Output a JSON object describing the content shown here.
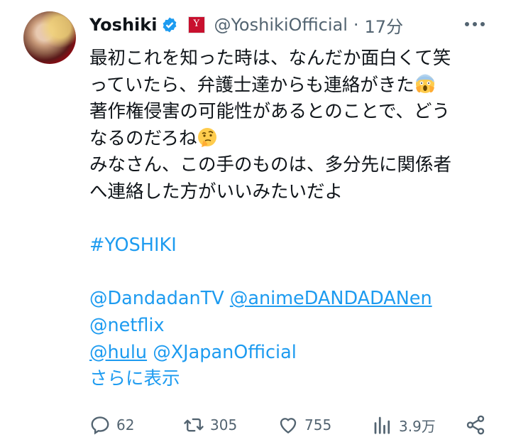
{
  "author": {
    "name": "Yoshiki",
    "handle": "@YoshikiOfficial",
    "separator": "·",
    "time": "17分"
  },
  "tweet": {
    "lines": [
      "最初これを知った時は、なんだか面白くて笑",
      "っていたら、弁護士達からも連絡がきた",
      "著作権侵害の可能性があるとのことで、どう",
      "なるのだろね",
      "みなさん、この手のものは、多分先に関係者",
      "へ連絡した方がいいみたいだよ"
    ],
    "hashtag": "#YOSHIKI",
    "mentions": [
      "@DandadanTV",
      "@animeDANDADANen",
      "@netflix",
      "@hulu",
      "@XJapanOfficial"
    ],
    "show_more": "さらに表示"
  },
  "icons": {
    "verified": "verified-badge-icon",
    "affiliation": "affiliate-logo-icon",
    "more": "more-horizontal-icon",
    "screaming_emoji": "face-screaming-in-fear-emoji",
    "thinking_emoji": "thinking-face-emoji"
  },
  "actions": {
    "replies": "62",
    "reposts": "305",
    "likes": "755",
    "views": "3.9万"
  },
  "colors": {
    "link": "#1d9bf0",
    "muted": "#536471",
    "text": "#0f1419",
    "affiliate": "#c8102e"
  }
}
